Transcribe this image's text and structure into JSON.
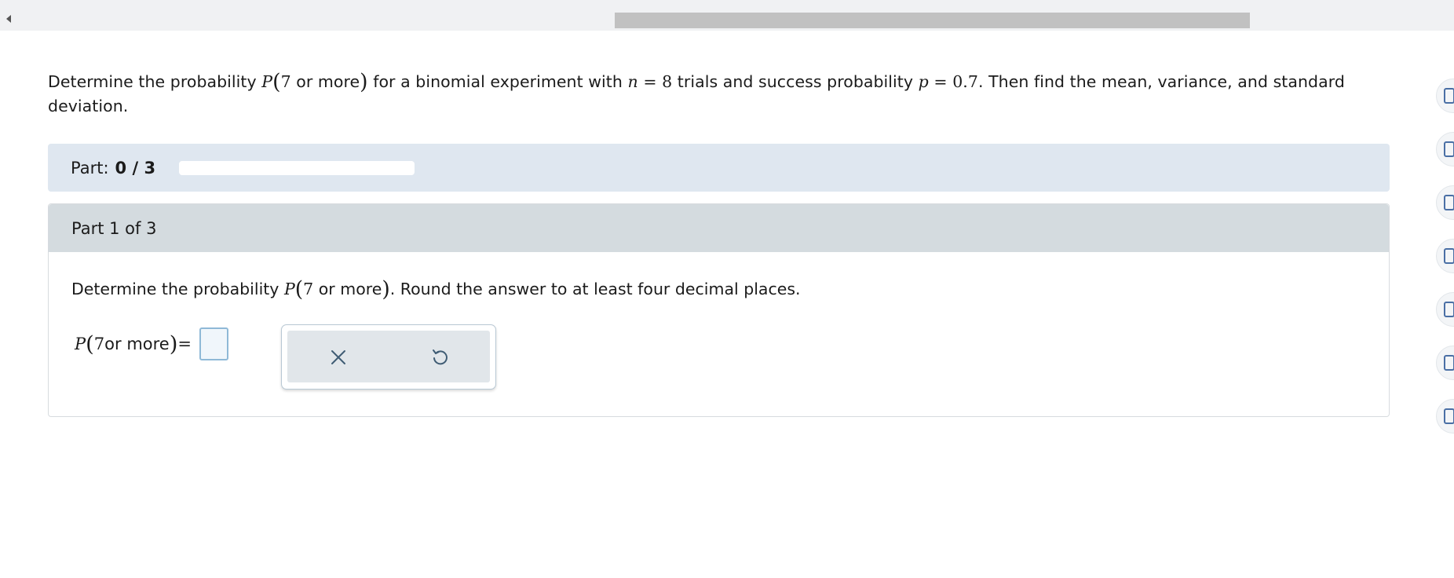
{
  "question": {
    "prefix": "Determine the probability ",
    "p_var": "P",
    "seven": "7",
    "or_more": " or more",
    "middle": " for a binomial experiment with ",
    "n_var": "n",
    "eq1": " = ",
    "n_val": "8",
    "trials": " trials and success probability ",
    "p_small": "p",
    "eq2": " = ",
    "p_val": "0.7",
    "suffix": ". Then find the mean, variance, and standard deviation."
  },
  "part_bar": {
    "label": "Part:",
    "value": "0 / 3",
    "progress": 0
  },
  "panel": {
    "header": "Part 1 of 3",
    "instruction_prefix": "Determine the probability ",
    "instruction_p": "P",
    "instruction_seven": "7",
    "instruction_or_more": " or more",
    "instruction_suffix": ". Round the answer to at least four decimal places.",
    "answer_label_p": "P",
    "answer_label_seven": "7",
    "answer_label_or_more": " or more",
    "answer_eq": " =",
    "answer_value": ""
  },
  "toolbox": {
    "clear_icon": "close-icon",
    "undo_icon": "undo-icon"
  },
  "colors": {
    "part_bar_bg": "#dfe7f0",
    "panel_header_bg": "#d4dbdf",
    "icon_color": "#3f5c74"
  }
}
